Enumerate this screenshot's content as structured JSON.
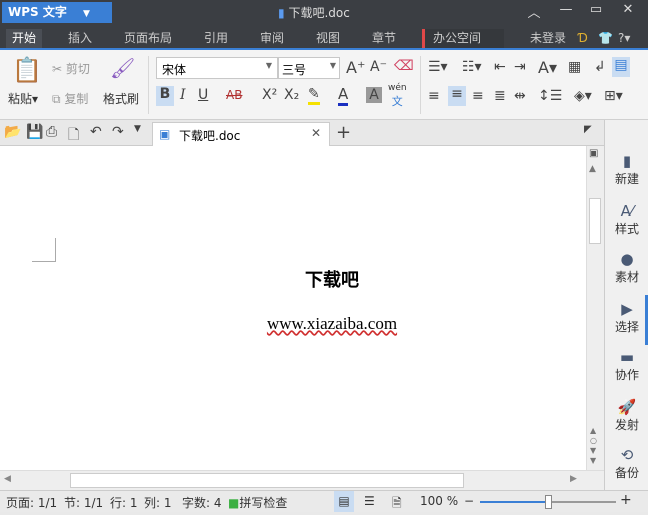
{
  "title_bar": {
    "app_label": "WPS 文字",
    "document_title": "下载吧.doc"
  },
  "menu_tabs": [
    "开始",
    "插入",
    "页面布局",
    "引用",
    "审阅",
    "视图",
    "章节",
    "办公空间"
  ],
  "account": {
    "login": "未登录"
  },
  "ribbon": {
    "paste": "粘贴",
    "cut": "剪切",
    "copy": "复制",
    "format_painter": "格式刷",
    "font_name": "宋体",
    "font_size": "三号",
    "bold": "B",
    "italic": "I",
    "underline": "U",
    "strike": "AB",
    "superscript": "X²",
    "subscript": "X₂",
    "phonetic": "wén"
  },
  "document_tab": {
    "name": "下载吧.doc"
  },
  "document": {
    "heading": "下载吧",
    "url": "www.xiazaiba.com"
  },
  "sidebar": [
    {
      "label": "新建",
      "icon": "new-doc-icon"
    },
    {
      "label": "样式",
      "icon": "style-icon"
    },
    {
      "label": "素材",
      "icon": "material-icon"
    },
    {
      "label": "选择",
      "icon": "select-icon"
    },
    {
      "label": "协作",
      "icon": "collab-icon"
    },
    {
      "label": "发射",
      "icon": "send-icon"
    },
    {
      "label": "备份",
      "icon": "backup-icon"
    }
  ],
  "status": {
    "page": "页面: 1/1",
    "section": "节: 1/1",
    "row": "行: 1",
    "col": "列: 1",
    "words": "字数: 4",
    "spellcheck": "拼写检查",
    "zoom": "100 %",
    "zoom_percent": 100
  },
  "colors": {
    "accent": "#3a7fd5",
    "titlebar": "#3b3e43"
  }
}
